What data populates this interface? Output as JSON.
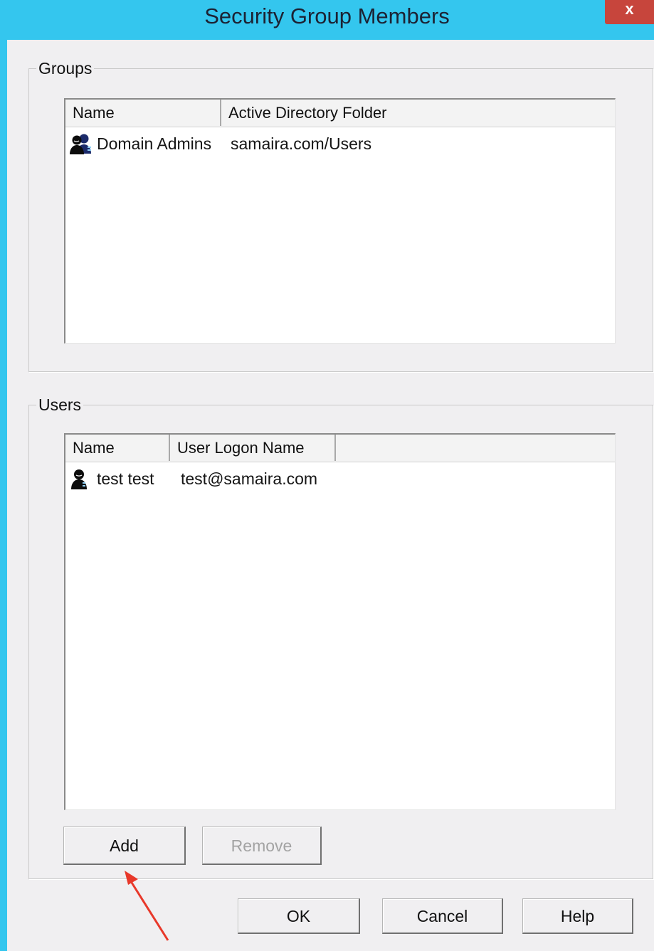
{
  "window": {
    "title": "Security Group Members",
    "close_label": "x"
  },
  "groups": {
    "label": "Groups",
    "columns": [
      "Name",
      "Active Directory Folder"
    ],
    "rows": [
      {
        "icon": "group-users-icon",
        "name": "Domain Admins",
        "folder": "samaira.com/Users"
      }
    ]
  },
  "users": {
    "label": "Users",
    "columns": [
      "Name",
      "User Logon Name",
      ""
    ],
    "rows": [
      {
        "icon": "user-icon",
        "name": "test test",
        "logon": "test@samaira.com"
      }
    ],
    "add_label": "Add",
    "remove_label": "Remove",
    "remove_enabled": false
  },
  "footer": {
    "ok_label": "OK",
    "cancel_label": "Cancel",
    "help_label": "Help"
  },
  "annotation": {
    "arrow_color": "#e8382a",
    "arrow_target": "add-button"
  },
  "colors": {
    "titlebar": "#34c6ee",
    "close_button": "#c7453c",
    "dialog_bg": "#f0eff1"
  }
}
